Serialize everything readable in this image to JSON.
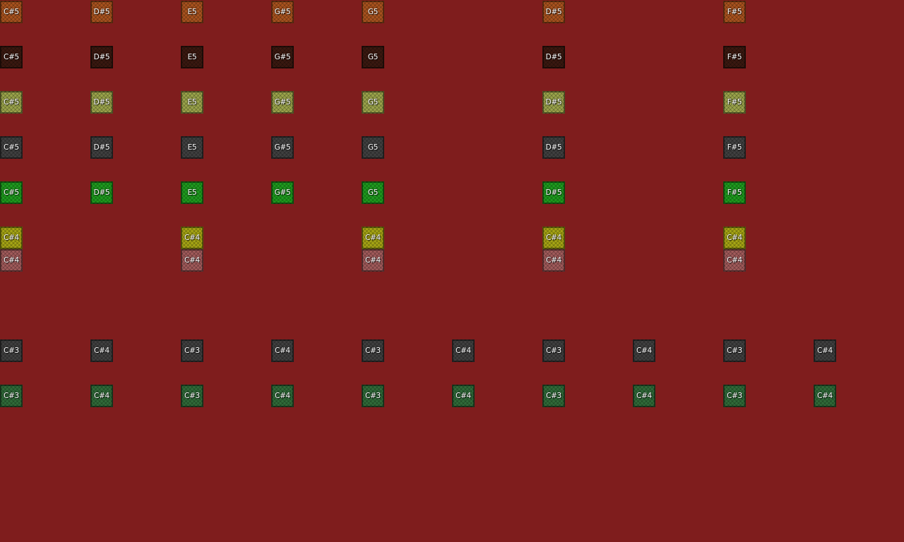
{
  "lanes": [
    {
      "color": "#a8521e",
      "notes": [
        {
          "col": 0,
          "label": "C#5"
        },
        {
          "col": 4,
          "label": "D#5"
        },
        {
          "col": 8,
          "label": "E5"
        },
        {
          "col": 12,
          "label": "G#5"
        },
        {
          "col": 16,
          "label": "G5"
        },
        {
          "col": 24,
          "label": "D#5"
        },
        {
          "col": 32,
          "label": "F#5"
        }
      ]
    },
    {
      "color": "#3a1810",
      "notes": [
        {
          "col": 0,
          "label": "C#5"
        },
        {
          "col": 4,
          "label": "D#5"
        },
        {
          "col": 8,
          "label": "E5"
        },
        {
          "col": 12,
          "label": "G#5"
        },
        {
          "col": 16,
          "label": "G5"
        },
        {
          "col": 24,
          "label": "D#5"
        },
        {
          "col": 32,
          "label": "F#5"
        }
      ]
    },
    {
      "color": "#9aa34a",
      "notes": [
        {
          "col": 0,
          "label": "C#5"
        },
        {
          "col": 4,
          "label": "D#5"
        },
        {
          "col": 8,
          "label": "E5"
        },
        {
          "col": 12,
          "label": "G#5"
        },
        {
          "col": 16,
          "label": "G5"
        },
        {
          "col": 24,
          "label": "D#5"
        },
        {
          "col": 32,
          "label": "F#5"
        }
      ]
    },
    {
      "color": "#3f3f3f",
      "notes": [
        {
          "col": 0,
          "label": "C#5"
        },
        {
          "col": 4,
          "label": "D#5"
        },
        {
          "col": 8,
          "label": "E5"
        },
        {
          "col": 12,
          "label": "G#5"
        },
        {
          "col": 16,
          "label": "G5"
        },
        {
          "col": 24,
          "label": "D#5"
        },
        {
          "col": 32,
          "label": "F#5"
        }
      ]
    },
    {
      "color": "#1e9a1e",
      "notes": [
        {
          "col": 0,
          "label": "C#5"
        },
        {
          "col": 4,
          "label": "D#5"
        },
        {
          "col": 8,
          "label": "E5"
        },
        {
          "col": 12,
          "label": "G#5"
        },
        {
          "col": 16,
          "label": "G5"
        },
        {
          "col": 24,
          "label": "D#5"
        },
        {
          "col": 32,
          "label": "F#5"
        }
      ]
    },
    {
      "color": "#a5a414",
      "notes": [
        {
          "col": 0,
          "label": "C#4"
        },
        {
          "col": 8,
          "label": "C#4"
        },
        {
          "col": 16,
          "label": "C#4"
        },
        {
          "col": 24,
          "label": "C#4"
        },
        {
          "col": 32,
          "label": "C#4"
        }
      ]
    },
    {
      "color": "#a05a5a",
      "notes": [
        {
          "col": 0,
          "label": "C#4"
        },
        {
          "col": 8,
          "label": "C#4"
        },
        {
          "col": 16,
          "label": "C#4"
        },
        {
          "col": 24,
          "label": "C#4"
        },
        {
          "col": 32,
          "label": "C#4"
        }
      ]
    },
    {
      "color": "#3f3f3f",
      "notes": [
        {
          "col": 0,
          "label": "C#3"
        },
        {
          "col": 4,
          "label": "C#4"
        },
        {
          "col": 8,
          "label": "C#3"
        },
        {
          "col": 12,
          "label": "C#4"
        },
        {
          "col": 16,
          "label": "C#3"
        },
        {
          "col": 20,
          "label": "C#4"
        },
        {
          "col": 24,
          "label": "C#3"
        },
        {
          "col": 28,
          "label": "C#4"
        },
        {
          "col": 32,
          "label": "C#3"
        },
        {
          "col": 36,
          "label": "C#4"
        }
      ]
    },
    {
      "color": "#2f6a38",
      "notes": [
        {
          "col": 0,
          "label": "C#3"
        },
        {
          "col": 4,
          "label": "C#4"
        },
        {
          "col": 8,
          "label": "C#3"
        },
        {
          "col": 12,
          "label": "C#4"
        },
        {
          "col": 16,
          "label": "C#3"
        },
        {
          "col": 20,
          "label": "C#4"
        },
        {
          "col": 24,
          "label": "C#3"
        },
        {
          "col": 28,
          "label": "C#4"
        },
        {
          "col": 32,
          "label": "C#3"
        },
        {
          "col": 36,
          "label": "C#4"
        }
      ]
    }
  ]
}
